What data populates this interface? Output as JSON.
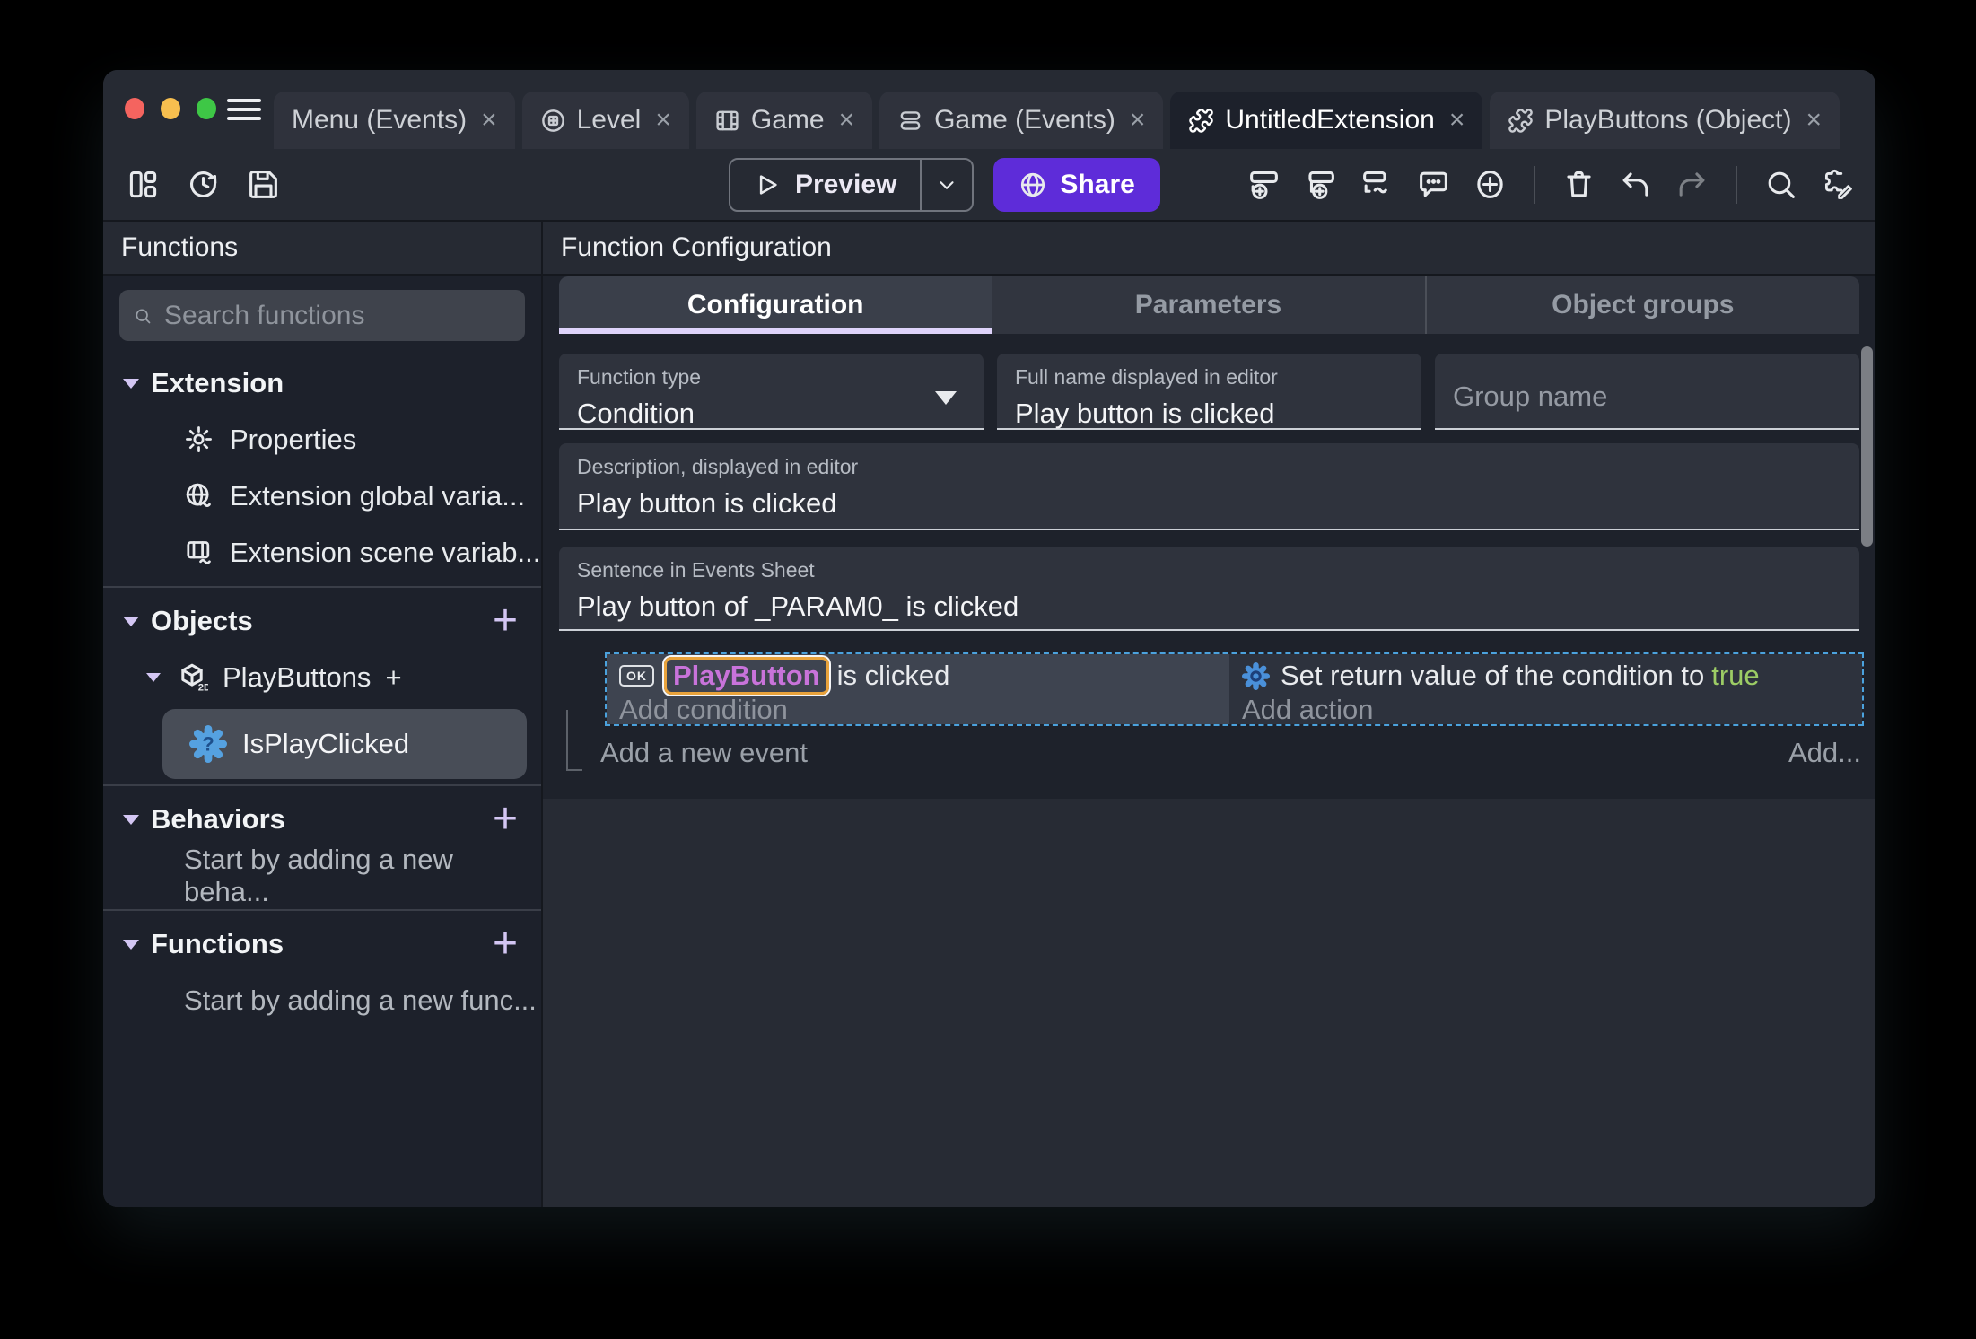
{
  "tabbar": {
    "close": "×",
    "tabs": [
      {
        "label": "Menu (Events)"
      },
      {
        "label": "Level"
      },
      {
        "label": "Game"
      },
      {
        "label": "Game (Events)"
      },
      {
        "label": "UntitledExtension"
      },
      {
        "label": "PlayButtons (Object)"
      }
    ]
  },
  "toolbar": {
    "preview": "Preview",
    "share": "Share"
  },
  "sidebar": {
    "title": "Functions",
    "search_placeholder": "Search functions",
    "sections": [
      {
        "label": "Extension",
        "items": [
          "Properties",
          "Extension global varia...",
          "Extension scene variab..."
        ]
      },
      {
        "label": "Objects",
        "object": "PlayButtons",
        "function": "IsPlayClicked"
      },
      {
        "label": "Behaviors",
        "empty": "Start by adding a new beha..."
      },
      {
        "label": "Functions",
        "empty": "Start by adding a new func..."
      }
    ]
  },
  "main": {
    "title": "Function Configuration",
    "tabs": [
      "Configuration",
      "Parameters",
      "Object groups"
    ],
    "form": {
      "function_type": {
        "label": "Function type",
        "value": "Condition"
      },
      "full_name": {
        "label": "Full name displayed in editor",
        "value": "Play button is clicked"
      },
      "group_name": {
        "placeholder": "Group name"
      },
      "description": {
        "label": "Description, displayed in editor",
        "value": "Play button is clicked"
      },
      "sentence": {
        "label": "Sentence in Events Sheet",
        "value": "Play button of _PARAM0_ is clicked"
      }
    },
    "events": {
      "condition": {
        "object_button_label": "OK",
        "object_name": "PlayButton",
        "suffix": " is clicked",
        "placeholder": "Add condition"
      },
      "action": {
        "prefix": "Set return value of the condition to",
        "value": "true",
        "placeholder": "Add action"
      },
      "add_new_event": "Add a new event",
      "add_button": "Add..."
    }
  },
  "colors": {
    "accent_purple": "#5e2cd9",
    "tab_active_underline": "#ded3fa",
    "selection_dashed_border": "#4ba2dd",
    "object_name_text": "#c873da",
    "object_highlight_border": "#e9a33c",
    "boolean_true_green": "#9ccc65",
    "function_icon_blue": "#55a1e0",
    "traffic_red": "#f4645f",
    "traffic_yellow": "#f7bf4f",
    "traffic_green": "#3ec746"
  }
}
